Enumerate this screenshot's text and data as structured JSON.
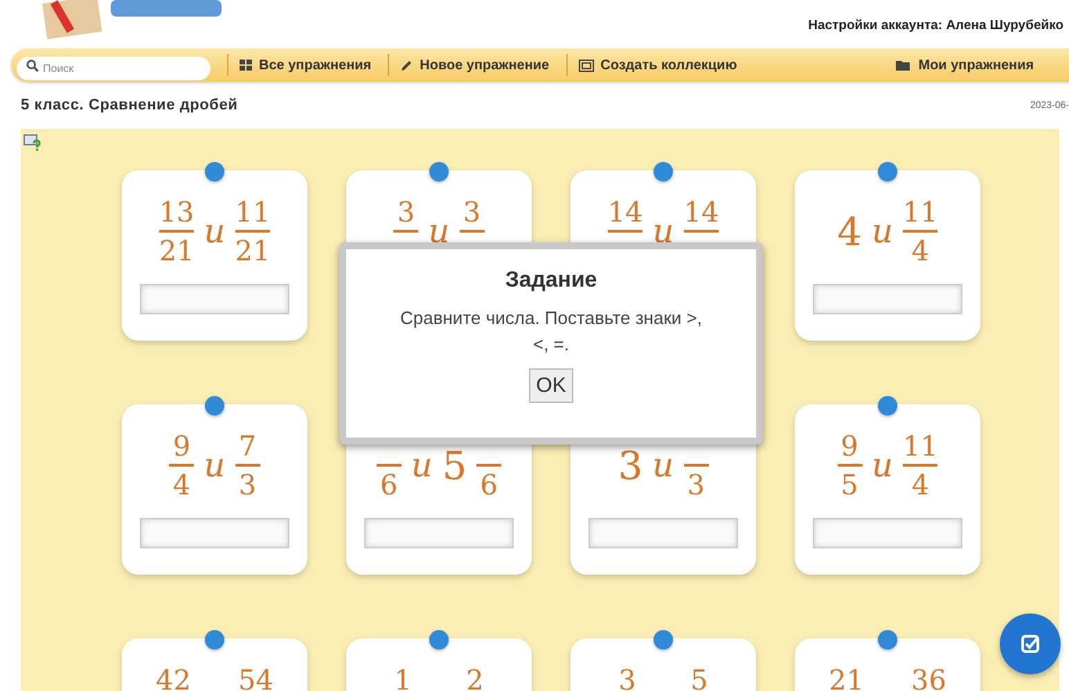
{
  "account": {
    "label": "Настройки аккаунта: Алена Шурубейко"
  },
  "nav": {
    "search_placeholder": "Поиск",
    "items": [
      {
        "kind": "grid",
        "label": "Все упражнения"
      },
      {
        "kind": "pencil",
        "label": "Новое упражнение"
      },
      {
        "kind": "collection",
        "label": "Создать коллекцию"
      },
      {
        "kind": "folder",
        "label": "Мои упражнения"
      }
    ]
  },
  "page": {
    "title": "5 класс. Сравнение дробей",
    "date": "2023-06-"
  },
  "cards": [
    {
      "connector": "и",
      "field": true,
      "terms": [
        {
          "num": "13",
          "den": "21"
        },
        {
          "num": "11",
          "den": "21"
        }
      ]
    },
    {
      "connector": "и",
      "field": false,
      "terms": [
        {
          "num": "3"
        },
        {
          "num": "3"
        }
      ]
    },
    {
      "connector": "и",
      "field": false,
      "terms": [
        {
          "num": "14"
        },
        {
          "num": "14"
        }
      ]
    },
    {
      "connector": "и",
      "field": true,
      "terms": [
        {
          "whole": "4"
        },
        {
          "num": "11",
          "den": "4"
        }
      ]
    },
    {
      "connector": "и",
      "field": true,
      "terms": [
        {
          "num": "9",
          "den": "4"
        },
        {
          "num": "7",
          "den": "3"
        }
      ]
    },
    {
      "connector": "и",
      "field": true,
      "terms": [
        {
          "den": "6"
        },
        {
          "whole": "5",
          "den": "6"
        }
      ]
    },
    {
      "connector": "и",
      "field": true,
      "terms": [
        {
          "whole": "3"
        },
        {
          "den": "3"
        }
      ]
    },
    {
      "connector": "и",
      "field": true,
      "terms": [
        {
          "num": "9",
          "den": "5"
        },
        {
          "num": "11",
          "den": "4"
        }
      ]
    },
    {
      "field": false,
      "terms": [
        {
          "num": "42"
        },
        {
          "num": "54"
        }
      ]
    },
    {
      "field": false,
      "terms": [
        {
          "num": "1"
        },
        {
          "num": "2"
        }
      ]
    },
    {
      "field": false,
      "terms": [
        {
          "num": "3"
        },
        {
          "num": "5"
        }
      ]
    },
    {
      "field": false,
      "terms": [
        {
          "num": "21"
        },
        {
          "num": "36"
        }
      ]
    }
  ],
  "dialog": {
    "title": "Задание",
    "message": "Сравните числа. Поставьте знаки >, <, =.",
    "button": "OK"
  }
}
